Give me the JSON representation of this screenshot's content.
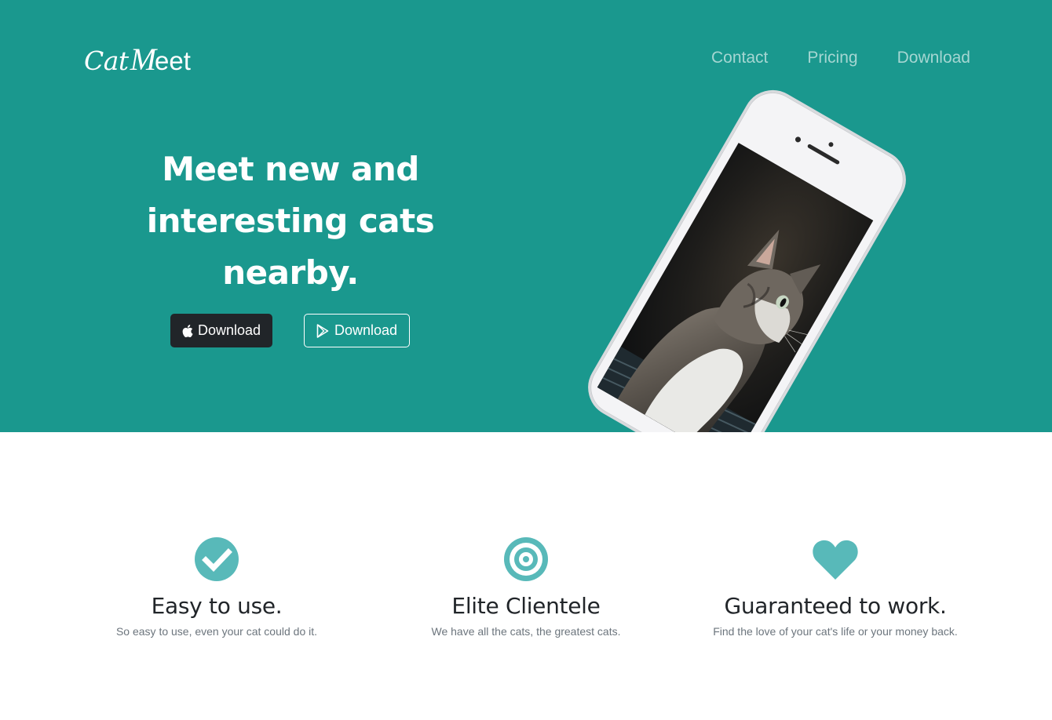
{
  "brand": {
    "part1": "Cat",
    "part2": "M",
    "part3": "eet"
  },
  "nav": {
    "items": [
      "Contact",
      "Pricing",
      "Download"
    ]
  },
  "hero": {
    "headline": [
      "Meet new and",
      "interesting cats",
      "nearby."
    ],
    "buttons": [
      {
        "label": "Download",
        "icon": "apple-icon"
      },
      {
        "label": "Download",
        "icon": "google-play-icon"
      }
    ],
    "phone_image": "cat-photo"
  },
  "features": [
    {
      "icon": "check-circle-icon",
      "title": "Easy to use.",
      "text": "So easy to use, even your cat could do it."
    },
    {
      "icon": "bullseye-icon",
      "title": "Elite Clientele",
      "text": "We have all the cats, the greatest cats."
    },
    {
      "icon": "heart-icon",
      "title": "Guaranteed to work.",
      "text": "Find the love of your cat's life or your money back."
    }
  ],
  "colors": {
    "primary": "#1a988e",
    "icon_accent": "#58b9b9",
    "dark_button": "#212529"
  }
}
